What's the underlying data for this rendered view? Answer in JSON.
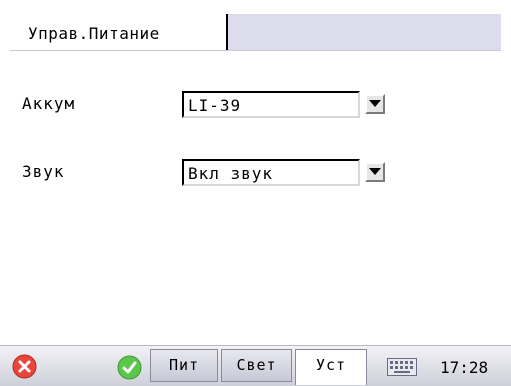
{
  "header": {
    "tab_label": "Управ.Питание"
  },
  "form": {
    "rows": [
      {
        "label": "Аккум",
        "value": "LI-39"
      },
      {
        "label": "Звук",
        "value": "Вкл звук"
      }
    ]
  },
  "taskbar": {
    "buttons": [
      {
        "label": "Пит",
        "active": false
      },
      {
        "label": "Свет",
        "active": false
      },
      {
        "label": "Уст",
        "active": true
      }
    ],
    "icons": [
      "close-icon",
      "ok-icon",
      "keyboard-icon"
    ],
    "clock": "17:28"
  },
  "colors": {
    "close": "#e8453c",
    "ok": "#5cc64a",
    "header_strip": "#dcdcec"
  }
}
